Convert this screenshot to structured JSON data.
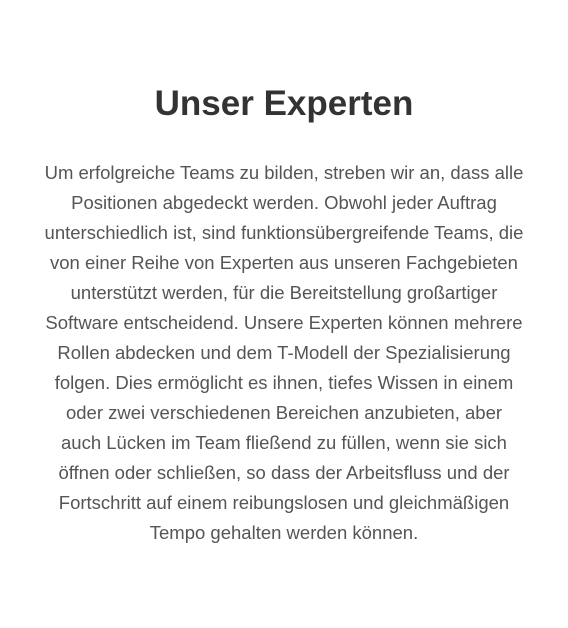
{
  "section": {
    "title": "Unser Experten",
    "paragraph_lines": [
      "Um erfolgreiche Teams zu bilden, streben wir an, dass alle",
      "Positionen abgedeckt werden. Obwohl jeder Auftrag",
      "unterschiedlich ist, sind funktionsübergreifende Teams, die",
      "von einer Reihe von Experten aus unseren Fachgebieten",
      "unterstützt werden, für die Bereitstellung großartiger",
      "Software entscheidend. Unsere Experten können mehrere",
      "Rollen abdecken und dem T-Modell der Spezialisierung",
      "folgen. Dies ermöglicht es ihnen, tiefes Wissen in einem",
      "oder zwei verschiedenen Bereichen anzubieten, aber",
      "auch Lücken im Team fließend zu füllen, wenn sie sich",
      "öffnen oder schließen, so dass der Arbeitsfluss und der",
      "Fortschritt auf einem reibungslosen und gleichmäßigen",
      "Tempo gehalten werden können."
    ]
  },
  "colors": {
    "background": "#ffffff",
    "heading": "#333333",
    "body_text": "#555555"
  }
}
